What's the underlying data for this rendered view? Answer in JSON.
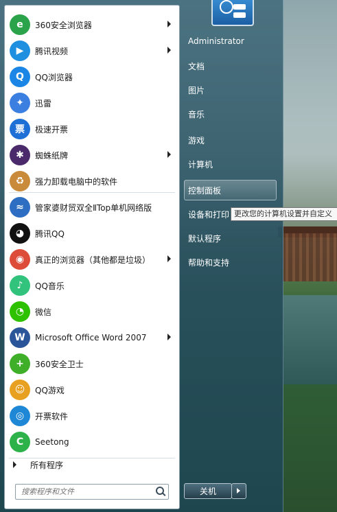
{
  "left_programs": [
    {
      "label": "360安全浏览器",
      "icon": "360-browser-icon",
      "color": "#2aa34a",
      "glyph": "e",
      "submenu": true
    },
    {
      "label": "腾讯视频",
      "icon": "tencent-video-icon",
      "color": "#1f8fe0",
      "glyph": "▶",
      "submenu": true
    },
    {
      "label": "QQ浏览器",
      "icon": "qq-browser-icon",
      "color": "#1b86e6",
      "glyph": "Q",
      "submenu": false
    },
    {
      "label": "迅雷",
      "icon": "thunder-icon",
      "color": "#3b7fe0",
      "glyph": "✦",
      "submenu": false
    },
    {
      "label": "极速开票",
      "icon": "invoice-icon",
      "color": "#1e6fd6",
      "glyph": "票",
      "submenu": false
    },
    {
      "label": "蜘蛛纸牌",
      "icon": "spider-solitaire-icon",
      "color": "#4a2a6a",
      "glyph": "✱",
      "submenu": true
    },
    {
      "label": "强力卸载电脑中的软件",
      "icon": "uninstall-box-icon",
      "color": "#c98a3a",
      "glyph": "♻",
      "submenu": false
    },
    {
      "label": "管家婆财贸双全ⅡTop单机网络版",
      "icon": "guanjiapo-icon",
      "color": "#2e6ec2",
      "glyph": "≈",
      "submenu": false
    },
    {
      "label": "腾讯QQ",
      "icon": "qq-penguin-icon",
      "color": "#111111",
      "glyph": "◕",
      "submenu": false
    },
    {
      "label": "真正的浏览器（其他都是垃圾）",
      "icon": "chrome-icon",
      "color": "#dd4b39",
      "glyph": "◉",
      "submenu": true
    },
    {
      "label": "QQ音乐",
      "icon": "qq-music-icon",
      "color": "#31c27c",
      "glyph": "♪",
      "submenu": false
    },
    {
      "label": "微信",
      "icon": "wechat-icon",
      "color": "#2dc100",
      "glyph": "◔",
      "submenu": false
    },
    {
      "label": "Microsoft Office Word 2007",
      "icon": "word-icon",
      "color": "#2a5699",
      "glyph": "W",
      "submenu": true
    },
    {
      "label": "360安全卫士",
      "icon": "360-safe-icon",
      "color": "#3fae29",
      "glyph": "+",
      "submenu": false
    },
    {
      "label": "QQ游戏",
      "icon": "qq-game-icon",
      "color": "#e8a020",
      "glyph": "☺",
      "submenu": false
    },
    {
      "label": "开票软件",
      "icon": "invoice-software-icon",
      "color": "#1e88d6",
      "glyph": "◎",
      "submenu": false
    },
    {
      "label": "Seetong",
      "icon": "seetong-icon",
      "color": "#2db24a",
      "glyph": "C",
      "submenu": false
    }
  ],
  "all_programs": "所有程序",
  "search": {
    "placeholder": "搜索程序和文件"
  },
  "right_links": [
    {
      "label": "Administrator"
    },
    {
      "label": "文档"
    },
    {
      "label": "图片"
    },
    {
      "label": "音乐"
    },
    {
      "label": "游戏"
    },
    {
      "label": "计算机"
    },
    {
      "label": "控制面板"
    },
    {
      "label": "设备和打印"
    },
    {
      "label": "默认程序"
    },
    {
      "label": "帮助和支持"
    }
  ],
  "tooltip": "更改您的计算机设置并自定义",
  "shutdown": {
    "label": "关机"
  }
}
